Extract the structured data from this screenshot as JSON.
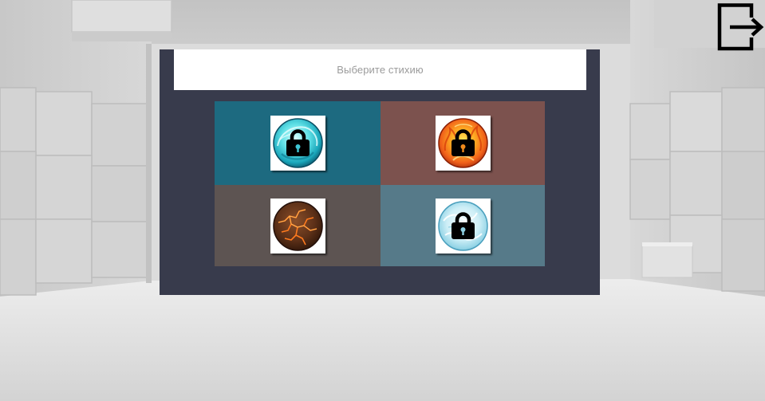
{
  "screen": {
    "exit_button": {
      "icon": "exit-icon"
    }
  },
  "panel": {
    "background": "#383b4c",
    "prompt": {
      "text": "Выберите стихию",
      "color": "#9b9b9b",
      "background": "#ffffff"
    },
    "lock_icon": "lock-icon",
    "tiles": [
      {
        "icon": "water-orb-icon",
        "locked": true,
        "background": "#1d6a80"
      },
      {
        "icon": "fire-orb-icon",
        "locked": true,
        "background": "#7c524e"
      },
      {
        "icon": "earth-orb-icon",
        "locked": false,
        "background": "#5d5452"
      },
      {
        "icon": "air-orb-icon",
        "locked": true,
        "background": "#567a89"
      }
    ]
  }
}
